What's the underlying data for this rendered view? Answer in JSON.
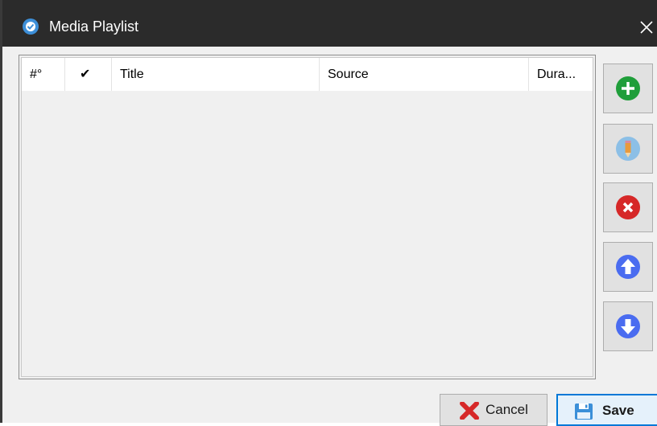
{
  "window": {
    "title": "Media Playlist",
    "app_icon": "app-logo-icon",
    "close_icon": "close-icon"
  },
  "grid": {
    "columns": [
      "#°",
      "✔",
      "Title",
      "Source",
      "Dura..."
    ],
    "rows": []
  },
  "side_buttons": [
    {
      "name": "add",
      "icon": "plus-circle-icon",
      "color": "#1f9e3a"
    },
    {
      "name": "edit",
      "icon": "pencil-icon",
      "color": "#5aa0d6",
      "disabled": true
    },
    {
      "name": "delete",
      "icon": "x-circle-icon",
      "color": "#d62828"
    },
    {
      "name": "move-up",
      "icon": "arrow-up-circle-icon",
      "color": "#4a6cf0"
    },
    {
      "name": "move-down",
      "icon": "arrow-down-circle-icon",
      "color": "#4a6cf0"
    }
  ],
  "footer": {
    "cancel_label": "Cancel",
    "save_label": "Save"
  },
  "colors": {
    "titlebar": "#2b2b2b",
    "accent": "#0078d7"
  }
}
